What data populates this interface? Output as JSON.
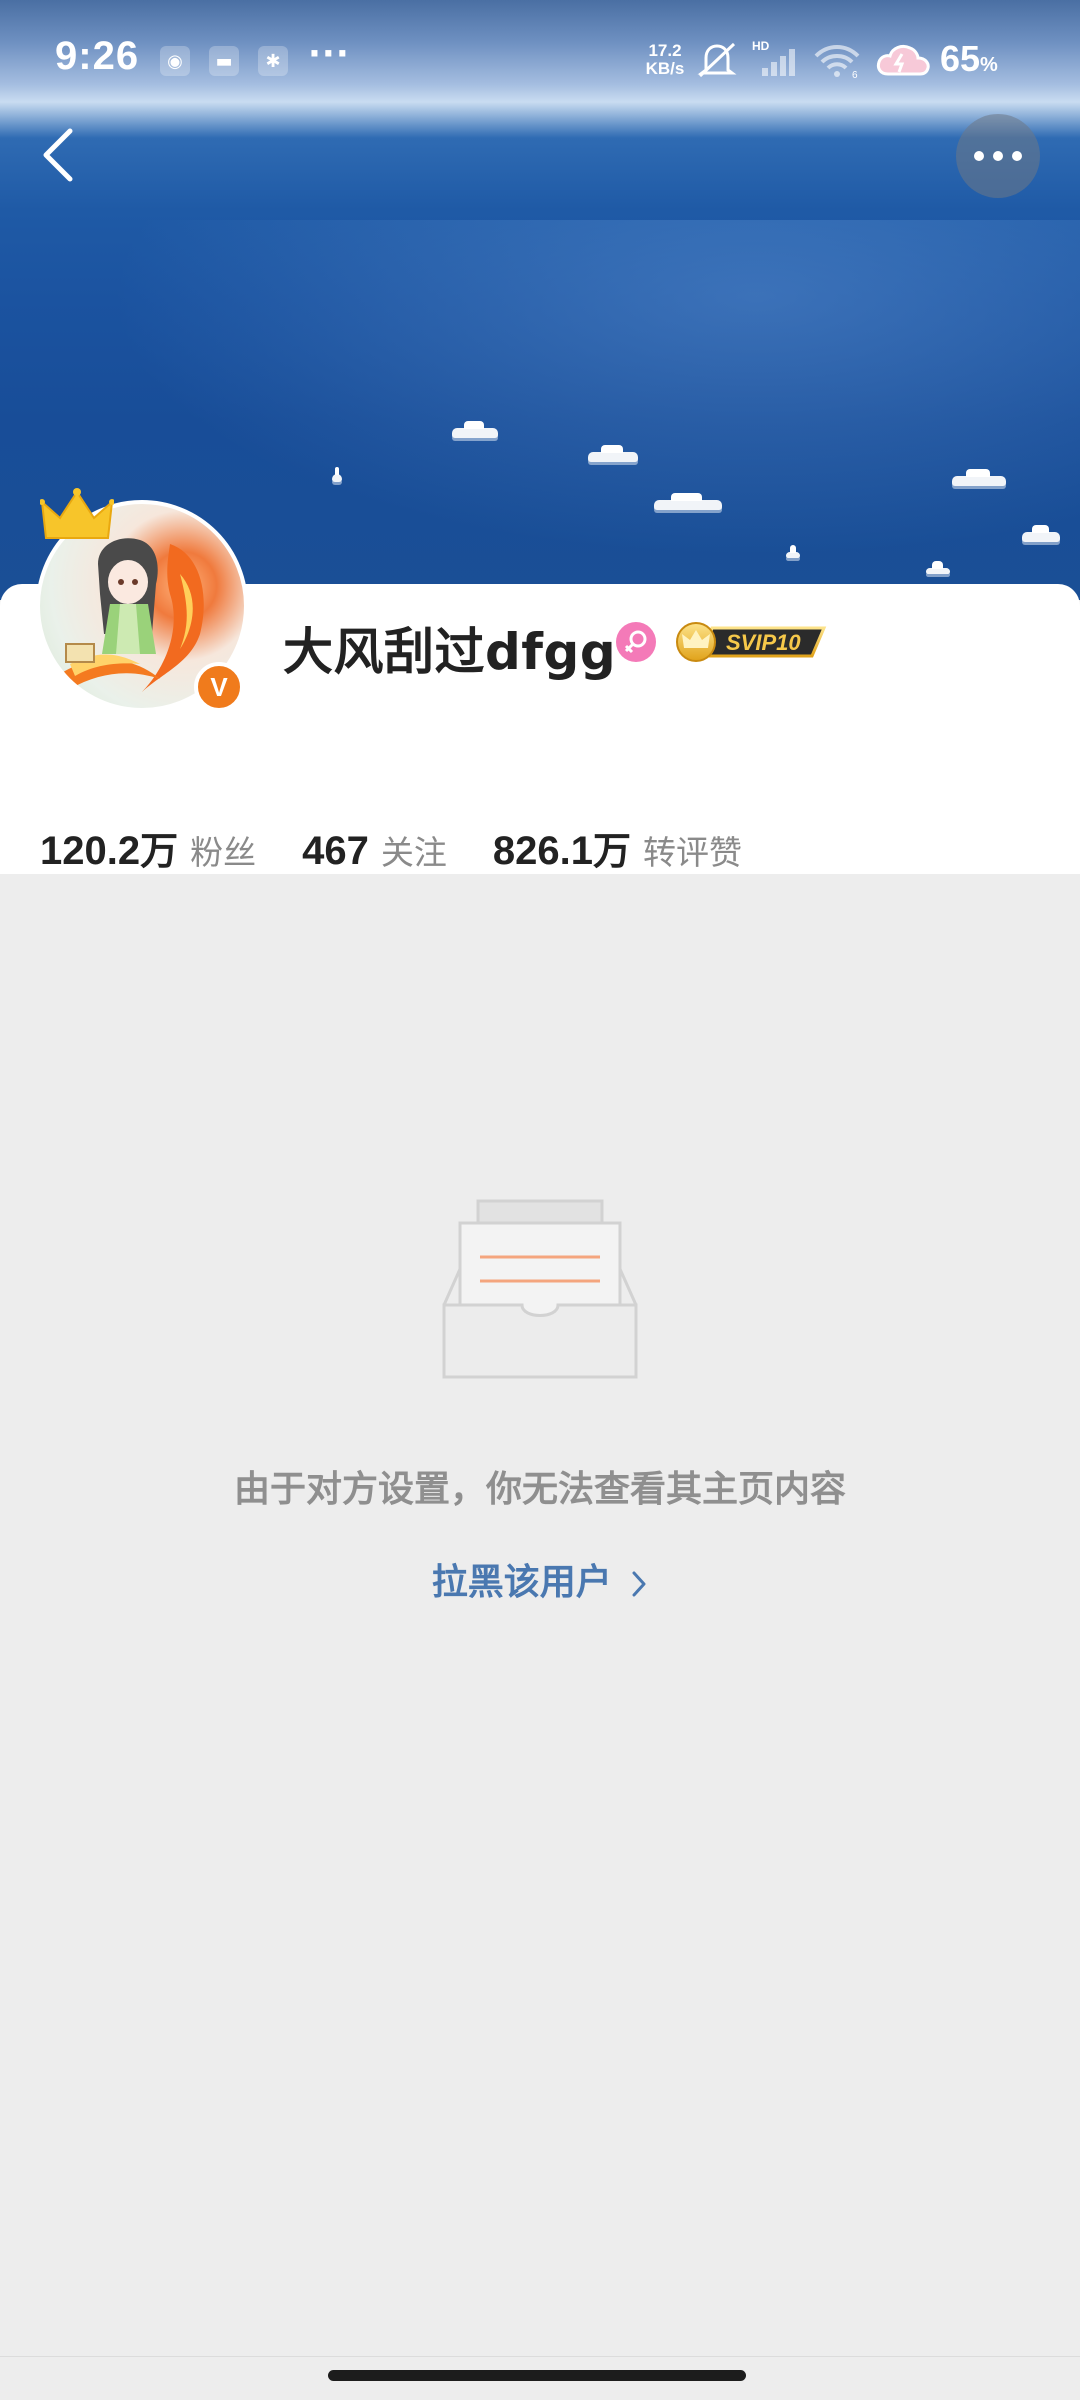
{
  "status_bar": {
    "time": "9:26",
    "notification_icons": [
      "weibo-icon",
      "app-icon",
      "app-icon-2"
    ],
    "more_dots": "···",
    "net_speed_value": "17.2",
    "net_speed_unit": "KB/s",
    "battery_percent": "65",
    "battery_unit": "%"
  },
  "profile": {
    "username": "大风刮过dfgg",
    "vip_label": "SVIP10",
    "verified_mark": "V",
    "stats": [
      {
        "value": "120.2",
        "unit": "万",
        "label": "粉丝"
      },
      {
        "value": "467",
        "unit": "",
        "label": "关注"
      },
      {
        "value": "826.1",
        "unit": "万",
        "label": "转评赞"
      }
    ]
  },
  "empty_state": {
    "message": "由于对方设置，你无法查看其主页内容",
    "block_link": "拉黑该用户"
  },
  "colors": {
    "accent_orange": "#f07b1c",
    "link_blue": "#4a78b0",
    "gender_pink": "#f47ab8"
  }
}
